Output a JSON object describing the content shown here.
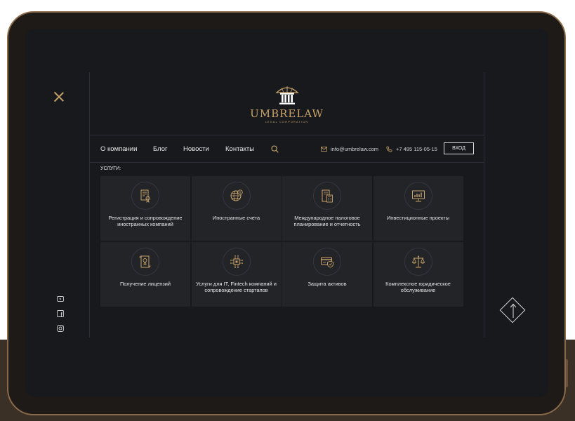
{
  "brand": {
    "name": "UMBRELAW",
    "tagline": "LEGAL CORPORATION"
  },
  "nav": {
    "items": [
      "О компании",
      "Блог",
      "Новости",
      "Контакты"
    ],
    "email": "info@umbrelaw.com",
    "phone": "+7 495 115-05-15",
    "login_label": "ВХОД"
  },
  "services": {
    "label": "УСЛУГИ:",
    "items": [
      {
        "title": "Регистрация и сопровождение иностранных компаний",
        "icon": "certificate-icon"
      },
      {
        "title": "Иностранные счета",
        "icon": "globe-dollar-icon"
      },
      {
        "title": "Международное налоговое планирование и отчетность",
        "icon": "calculator-document-icon"
      },
      {
        "title": "Инвестиционные проекты",
        "icon": "presentation-chart-icon"
      },
      {
        "title": "Получение лицензий",
        "icon": "license-scroll-icon"
      },
      {
        "title": "Услуги для IT, Fintech компаний и сопровождение стартапов",
        "icon": "chip-icon"
      },
      {
        "title": "Защита активов",
        "icon": "card-shield-icon"
      },
      {
        "title": "Комплексное юридическое обслуживание",
        "icon": "scales-icon"
      }
    ]
  },
  "social": [
    "youtube-icon",
    "facebook-icon",
    "instagram-icon"
  ],
  "colors": {
    "accent": "#c9a46a",
    "background": "#17191d",
    "card": "#222428"
  }
}
